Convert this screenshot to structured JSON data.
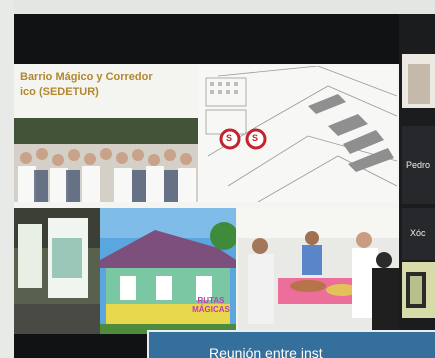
{
  "slide": {
    "title_line1": "Barrio  Mágico  y  Corredor",
    "title_line2": "ico (SEDETUR)",
    "sign_text": "RUTAS MÁGICAS",
    "map_markers": [
      "S",
      "S"
    ]
  },
  "participants": [
    {
      "name": "Pedro"
    },
    {
      "name": "Xóc"
    }
  ],
  "caption": {
    "text": "Reunión entre inst"
  },
  "colors": {
    "title": "#b3872f",
    "caption_bg": "#356f9b",
    "marker": "#c4232b"
  }
}
